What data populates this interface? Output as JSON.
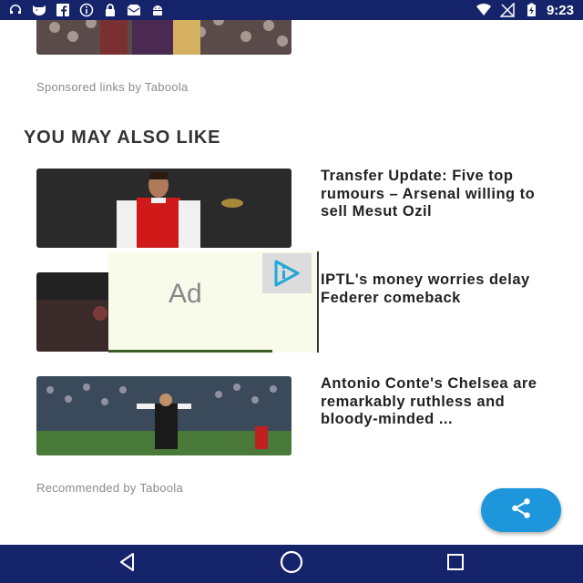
{
  "status_bar": {
    "time": "9:23",
    "left_icons": [
      "headset-icon",
      "mask-icon",
      "facebook-icon",
      "info-icon",
      "lock-icon",
      "mail-icon",
      "android-icon"
    ],
    "right_icons": [
      "wifi-icon",
      "no-signal-icon",
      "battery-charging-icon"
    ]
  },
  "top_section": {
    "sponsored_text": "Sponsored links by Taboola"
  },
  "recommendations": {
    "title": "YOU MAY ALSO LIKE",
    "items": [
      {
        "headline": "Transfer Update: Five top rumours – Arsenal willing to sell Mesut Ozil"
      },
      {
        "headline": "IPTL's money worries delay Federer comeback"
      },
      {
        "headline": "Antonio Conte's Chelsea are remarkably ruthless and bloody-minded ..."
      }
    ],
    "footer_text": "Recommended by Taboola"
  },
  "ad_overlay": {
    "label": "Ad",
    "logo": "ad-brand-logo-icon"
  },
  "fab": {
    "icon": "share-icon"
  },
  "nav_bar": {
    "buttons": [
      "back-icon",
      "home-icon",
      "recents-icon"
    ]
  },
  "colors": {
    "status_bar": "#15246a",
    "fab": "#1e96dc",
    "headline_text": "#222222",
    "meta_text": "#8a8a8a"
  }
}
